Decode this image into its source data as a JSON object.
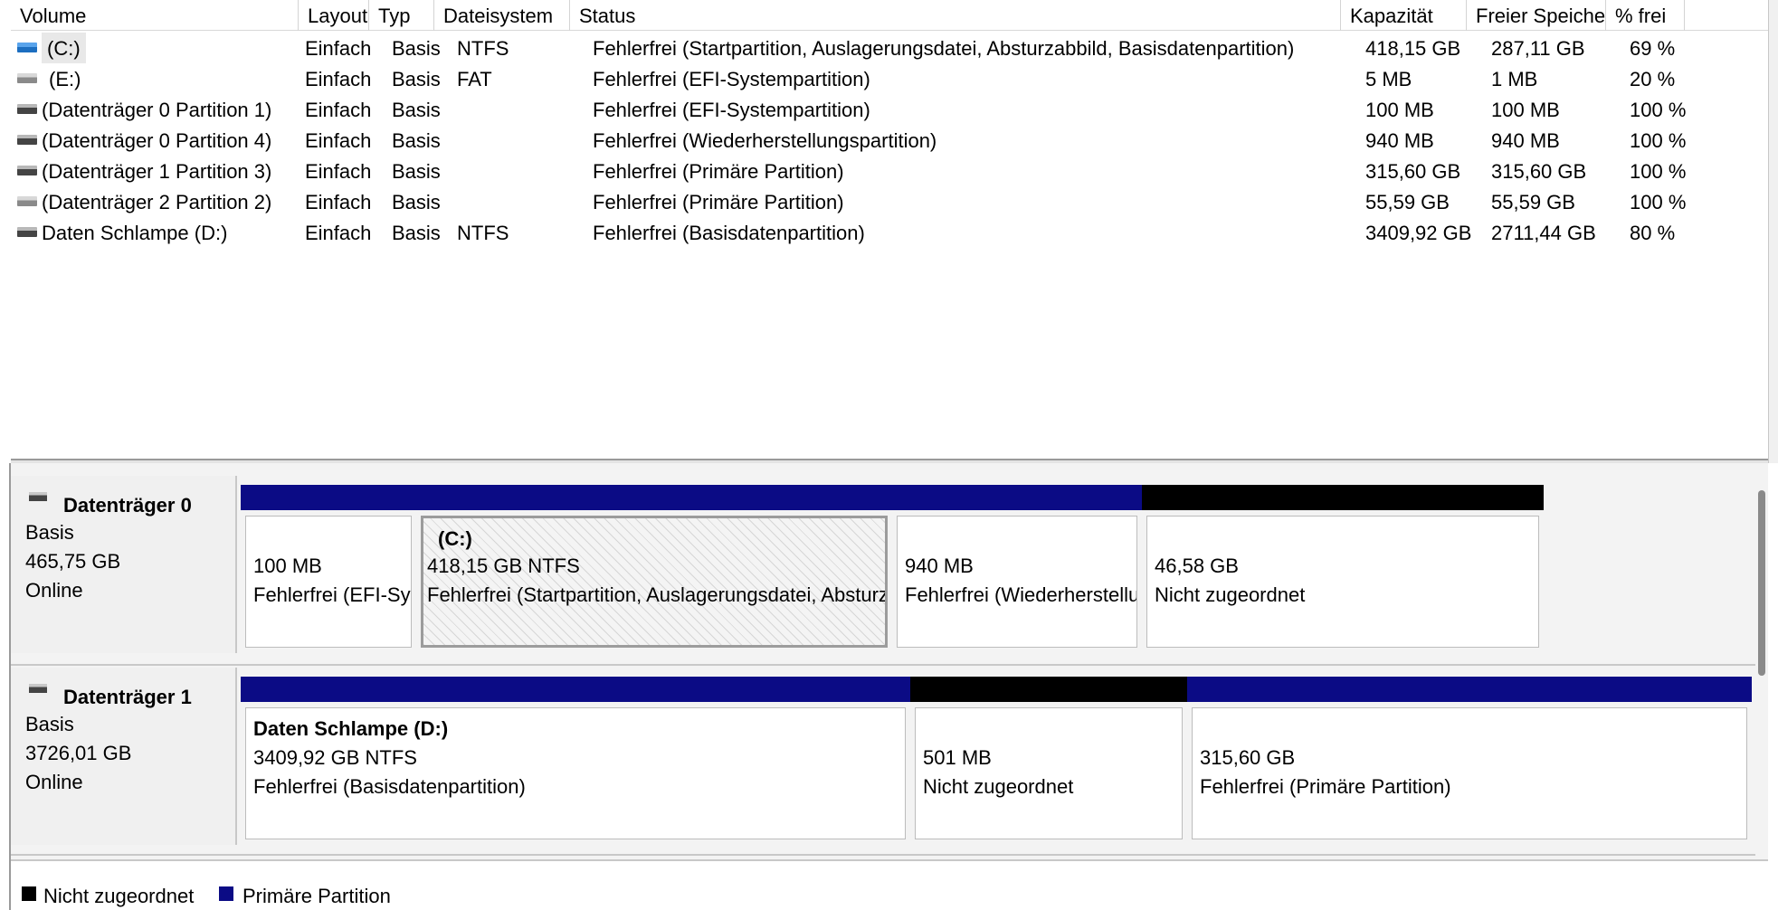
{
  "columns": [
    "Volume",
    "Layout",
    "Typ",
    "Dateisystem",
    "Status",
    "Kapazität",
    "Freier Speicher",
    "% frei"
  ],
  "volumes": [
    {
      "icon": "volume-blue-icon",
      "volume": "(C:)",
      "layout": "Einfach",
      "typ": "Basis",
      "fs": "NTFS",
      "status": "Fehlerfrei (Startpartition, Auslagerungsdatei, Absturzabbild, Basisdatenpartition)",
      "cap": "418,15 GB",
      "free": "287,11 GB",
      "pct": "69 %"
    },
    {
      "icon": "volume-gray-icon",
      "volume": "(E:)",
      "layout": "Einfach",
      "typ": "Basis",
      "fs": "FAT",
      "status": "Fehlerfrei (EFI-Systempartition)",
      "cap": "5 MB",
      "free": "1 MB",
      "pct": "20 %"
    },
    {
      "icon": "volume-dark-icon",
      "volume": "(Datenträger 0 Partition 1)",
      "layout": "Einfach",
      "typ": "Basis",
      "fs": "",
      "status": "Fehlerfrei (EFI-Systempartition)",
      "cap": "100 MB",
      "free": "100 MB",
      "pct": "100 %"
    },
    {
      "icon": "volume-dark-icon",
      "volume": "(Datenträger 0 Partition 4)",
      "layout": "Einfach",
      "typ": "Basis",
      "fs": "",
      "status": "Fehlerfrei (Wiederherstellungspartition)",
      "cap": "940 MB",
      "free": "940 MB",
      "pct": "100 %"
    },
    {
      "icon": "volume-dark-icon",
      "volume": "(Datenträger 1 Partition 3)",
      "layout": "Einfach",
      "typ": "Basis",
      "fs": "",
      "status": "Fehlerfrei (Primäre Partition)",
      "cap": "315,60 GB",
      "free": "315,60 GB",
      "pct": "100 %"
    },
    {
      "icon": "volume-gray-icon",
      "volume": "(Datenträger 2 Partition 2)",
      "layout": "Einfach",
      "typ": "Basis",
      "fs": "",
      "status": "Fehlerfrei (Primäre Partition)",
      "cap": "55,59 GB",
      "free": "55,59 GB",
      "pct": "100 %"
    },
    {
      "icon": "volume-dark-icon",
      "volume": "Daten Schlampe (D:)",
      "layout": "Einfach",
      "typ": "Basis",
      "fs": "NTFS",
      "status": "Fehlerfrei (Basisdatenpartition)",
      "cap": "3409,92 GB",
      "free": "2711,44 GB",
      "pct": "80 %"
    }
  ],
  "disk0": {
    "title": "Datenträger 0",
    "type": "Basis",
    "size": "465,75 GB",
    "state": "Online",
    "partitions": [
      {
        "kind": "primary",
        "line1": "100 MB",
        "line2": "Fehlerfrei (EFI-Systempartition)"
      },
      {
        "kind": "primary",
        "name": "(C:)",
        "line1": "418,15 GB NTFS",
        "line2": "Fehlerfrei (Startpartition, Auslagerungsdatei, Absturzabbild, Basisdatenpartition)"
      },
      {
        "kind": "primary",
        "line1": "940 MB",
        "line2": "Fehlerfrei (Wiederherstellungspartition)"
      },
      {
        "kind": "unallocated",
        "line1": "46,58 GB",
        "line2": "Nicht zugeordnet"
      }
    ]
  },
  "disk1": {
    "title": "Datenträger 1",
    "type": "Basis",
    "size": "3726,01 GB",
    "state": "Online",
    "partitions": [
      {
        "kind": "primary",
        "name": "Daten Schlampe  (D:)",
        "line1": "3409,92 GB NTFS",
        "line2": "Fehlerfrei (Basisdatenpartition)"
      },
      {
        "kind": "unallocated",
        "line1": "501 MB",
        "line2": "Nicht zugeordnet"
      },
      {
        "kind": "primary",
        "line1": "315,60 GB",
        "line2": "Fehlerfrei (Primäre Partition)"
      }
    ]
  },
  "legend": {
    "unallocated_label": "Nicht zugeordnet",
    "primary_label": "Primäre Partition",
    "unallocated_color": "#000000",
    "primary_color": "#0b0b85"
  },
  "colors": {
    "primary_bar": "#0b0b85",
    "unallocated_bar": "#000000",
    "selection_highlight": "#e8e8e8"
  }
}
